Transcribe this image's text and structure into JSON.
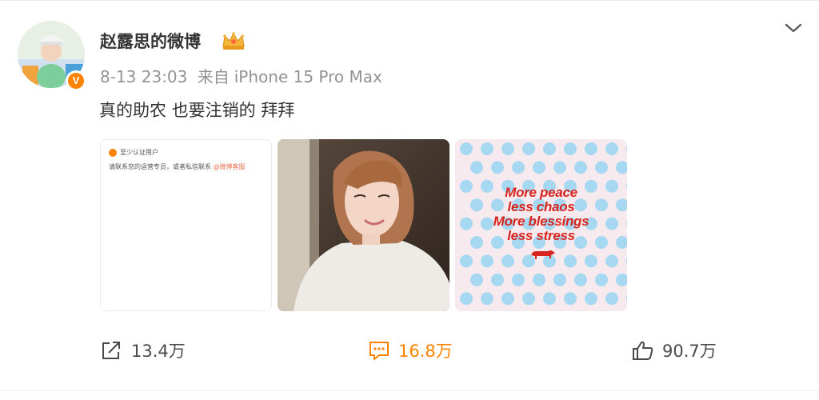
{
  "post": {
    "username": "赵露思的微博",
    "time": "8-13 23:03",
    "source_prefix": "来自",
    "source_device": "iPhone 15 Pro Max",
    "verified_badge": "V",
    "text": "真的助农 也要注销的 拜拜",
    "images": [
      {
        "type": "notice-screenshot",
        "label": "至少认证用户",
        "text": "请联系您的运营专员，或者私信联系",
        "link": "@微博客服"
      },
      {
        "type": "selfie-photo"
      },
      {
        "type": "polka-dot-slogan",
        "lines": [
          "More peace",
          "less chaos",
          "More blessings",
          "less stress"
        ],
        "dot_color": "#a6d8f2",
        "bg_color": "#f6eaef",
        "text_color": "#d8261f"
      }
    ]
  },
  "actions": {
    "repost_count": "13.4万",
    "comment_count": "16.8万",
    "like_count": "90.7万"
  },
  "icons": {
    "crown": "crown-badge-icon",
    "menu": "chevron-down-icon",
    "repost": "repost-icon",
    "comment": "comment-icon",
    "like": "thumbs-up-icon"
  },
  "colors": {
    "accent": "#ff8200",
    "meta_text": "#939393"
  }
}
